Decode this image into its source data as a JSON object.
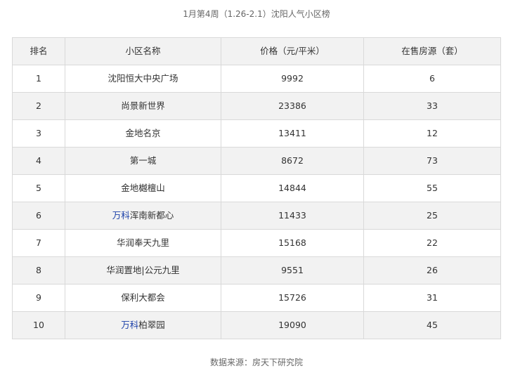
{
  "title": "1月第4周（1.26-2.1）沈阳人气小区榜",
  "table": {
    "headers": [
      "排名",
      "小区名称",
      "价格（元/平米）",
      "在售房源（套）"
    ],
    "rows": [
      {
        "rank": "1",
        "name_prefix": "",
        "name": "沈阳恒大中央广场",
        "price": "9992",
        "listings": "6"
      },
      {
        "rank": "2",
        "name_prefix": "",
        "name": "尚景新世界",
        "price": "23386",
        "listings": "33"
      },
      {
        "rank": "3",
        "name_prefix": "",
        "name": "金地名京",
        "price": "13411",
        "listings": "12"
      },
      {
        "rank": "4",
        "name_prefix": "",
        "name": "第一城",
        "price": "8672",
        "listings": "73"
      },
      {
        "rank": "5",
        "name_prefix": "",
        "name": "金地樾檀山",
        "price": "14844",
        "listings": "55"
      },
      {
        "rank": "6",
        "name_prefix": "万科",
        "name": "浑南新都心",
        "price": "11433",
        "listings": "25"
      },
      {
        "rank": "7",
        "name_prefix": "",
        "name": "华润奉天九里",
        "price": "15168",
        "listings": "22"
      },
      {
        "rank": "8",
        "name_prefix": "",
        "name": "华润置地|公元九里",
        "price": "9551",
        "listings": "26"
      },
      {
        "rank": "9",
        "name_prefix": "",
        "name": "保利大都会",
        "price": "15726",
        "listings": "31"
      },
      {
        "rank": "10",
        "name_prefix": "万科",
        "name": "柏翠园",
        "price": "19090",
        "listings": "45"
      }
    ]
  },
  "source": "数据来源：房天下研究院",
  "colors": {
    "brand_link": "#1a3fa8",
    "stripe": "#f2f2f2",
    "border": "#d9d9d9"
  }
}
